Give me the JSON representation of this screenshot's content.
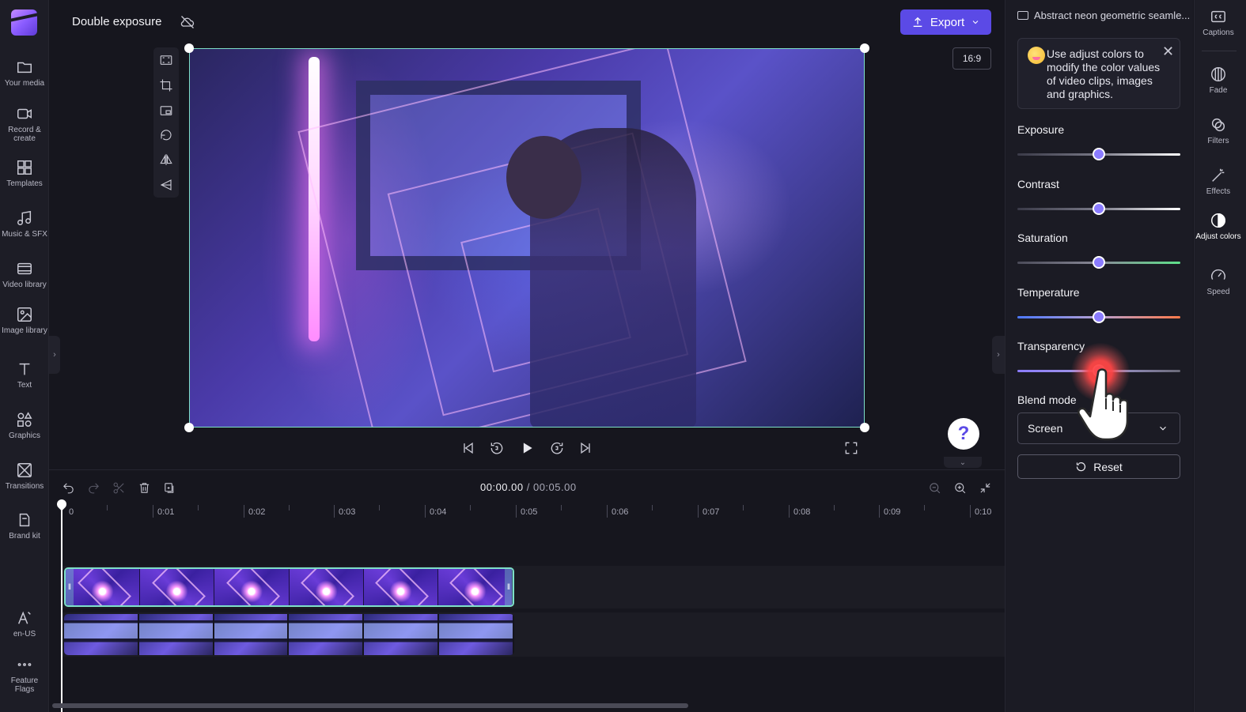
{
  "header": {
    "project_title": "Double exposure",
    "export_label": "Export",
    "aspect_ratio": "16:9"
  },
  "left_rail": {
    "items": [
      {
        "label": "Your media",
        "icon": "folder-icon"
      },
      {
        "label": "Record & create",
        "icon": "camera-icon"
      },
      {
        "label": "Templates",
        "icon": "templates-icon"
      },
      {
        "label": "Music & SFX",
        "icon": "music-icon"
      },
      {
        "label": "Video library",
        "icon": "film-icon"
      },
      {
        "label": "Image library",
        "icon": "image-icon"
      },
      {
        "label": "Text",
        "icon": "text-icon"
      },
      {
        "label": "Graphics",
        "icon": "shapes-icon"
      },
      {
        "label": "Transitions",
        "icon": "transitions-icon"
      },
      {
        "label": "Brand kit",
        "icon": "brand-kit-icon"
      }
    ],
    "bottom_items": [
      {
        "label": "en-US",
        "icon": "language-icon"
      },
      {
        "label": "Feature Flags",
        "icon": "more-icon"
      }
    ]
  },
  "timeline": {
    "current_time": "00:00.00",
    "total_time": "/ 00:05.00",
    "ruler_labels": [
      "0",
      "0:01",
      "0:02",
      "0:03",
      "0:04",
      "0:05",
      "0:06",
      "0:07",
      "0:08",
      "0:09",
      "0:10"
    ]
  },
  "right_panel": {
    "asset_name": "Abstract neon geometric seamle...",
    "tip_text": "Use adjust colors to modify the color values of video clips, images and graphics.",
    "adjustments": [
      {
        "label": "Exposure",
        "value": 0.5
      },
      {
        "label": "Contrast",
        "value": 0.5
      },
      {
        "label": "Saturation",
        "value": 0.5
      },
      {
        "label": "Temperature",
        "value": 0.5
      },
      {
        "label": "Transparency",
        "value": 0.5
      }
    ],
    "blend_mode_label": "Blend mode",
    "blend_mode_value": "Screen",
    "reset_label": "Reset"
  },
  "far_rail": {
    "items": [
      {
        "label": "Captions",
        "icon": "captions-icon"
      },
      {
        "label": "Fade",
        "icon": "fade-icon"
      },
      {
        "label": "Filters",
        "icon": "filters-icon"
      },
      {
        "label": "Effects",
        "icon": "effects-icon"
      },
      {
        "label": "Adjust colors",
        "icon": "adjust-colors-icon",
        "active": true
      },
      {
        "label": "Speed",
        "icon": "speed-icon"
      }
    ]
  },
  "colors": {
    "accent": "#5b4ae6",
    "selection": "#7ee0c8",
    "slider_thumb": "#8b7cff"
  }
}
